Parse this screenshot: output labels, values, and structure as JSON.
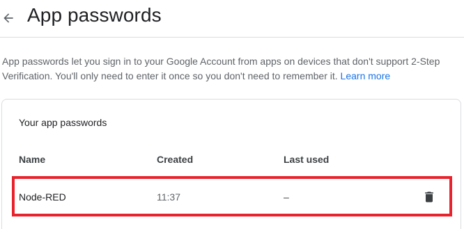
{
  "header": {
    "title": "App passwords"
  },
  "intro": {
    "text": "App passwords let you sign in to your Google Account from apps on devices that don't support 2-Step Verification. You'll only need to enter it once so you don't need to remember it.",
    "learn_more": "Learn more"
  },
  "card": {
    "title": "Your app passwords",
    "columns": [
      "Name",
      "Created",
      "Last used"
    ],
    "rows": [
      {
        "name": "Node-RED",
        "created": "11:37",
        "last_used": "–"
      }
    ]
  },
  "colors": {
    "accent": "#1a73e8",
    "highlight": "#e8232d",
    "text": "#202124",
    "muted": "#5f6368"
  },
  "icons": [
    "back-arrow-icon",
    "trash-icon"
  ]
}
